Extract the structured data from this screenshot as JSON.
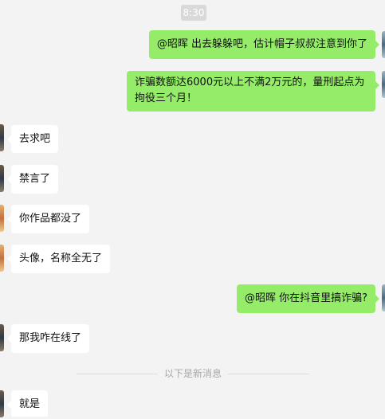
{
  "timestamp": "8:30",
  "messages": [
    {
      "side": "out",
      "text": "@昭晖 出去躲躲吧，估计帽子叔叔注意到你了"
    },
    {
      "side": "out",
      "text": "诈骗数额达6000元以上不满2万元的，量刑起点为拘役三个月！"
    },
    {
      "side": "in",
      "text": "去求吧"
    },
    {
      "side": "in",
      "text": "禁言了"
    },
    {
      "side": "in",
      "text": "你作品都没了"
    },
    {
      "side": "in",
      "text": "头像，名称全无了"
    },
    {
      "side": "out",
      "text": "@昭晖 你在抖音里搞诈骗?"
    },
    {
      "side": "in",
      "text": "那我咋在线了"
    },
    {
      "side": "in",
      "text": "就是"
    }
  ],
  "new_messages_divider": "以下是新消息",
  "colors": {
    "outgoing_bubble": "#95ec69",
    "incoming_bubble": "#ffffff",
    "background": "#f3f3f3"
  }
}
